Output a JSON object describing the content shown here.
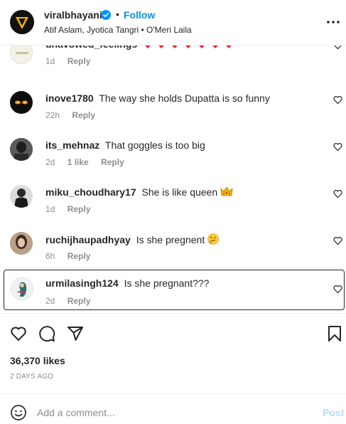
{
  "header": {
    "username": "viralbhayani",
    "dot": "•",
    "follow_label": "Follow",
    "audio": "Atif Aslam, Jyotica Tangri • O'Meri Laila"
  },
  "comments": [
    {
      "username": "unavowed_feelings",
      "text": "",
      "emoji": "hearts",
      "time": "1d",
      "likes": "",
      "reply": "Reply"
    },
    {
      "username": "inove1780",
      "text": "The way she holds Dupatta is so funny",
      "emoji": "",
      "time": "22h",
      "likes": "",
      "reply": "Reply"
    },
    {
      "username": "its_mehnaz",
      "text": "That goggles is too big",
      "emoji": "",
      "time": "2d",
      "likes": "1 like",
      "reply": "Reply"
    },
    {
      "username": "miku_choudhary17",
      "text": "She is like queen",
      "emoji": "crown",
      "time": "1d",
      "likes": "",
      "reply": "Reply"
    },
    {
      "username": "ruchijhaupadhyay",
      "text": "Is she pregnent",
      "emoji": "thinking",
      "time": "6h",
      "likes": "",
      "reply": "Reply"
    },
    {
      "username": "urmilasingh124",
      "text": "Is she pregnant???",
      "emoji": "",
      "time": "2d",
      "likes": "",
      "reply": "Reply"
    }
  ],
  "post": {
    "likes": "36,370 likes",
    "time_ago": "2 DAYS AGO"
  },
  "add_comment": {
    "placeholder": "Add a comment...",
    "post_label": "Post"
  },
  "colors": {
    "accent": "#0095f6",
    "post_disabled": "#b3dbff",
    "muted": "#8e8e8e",
    "heart_red": "#ed1c24"
  }
}
